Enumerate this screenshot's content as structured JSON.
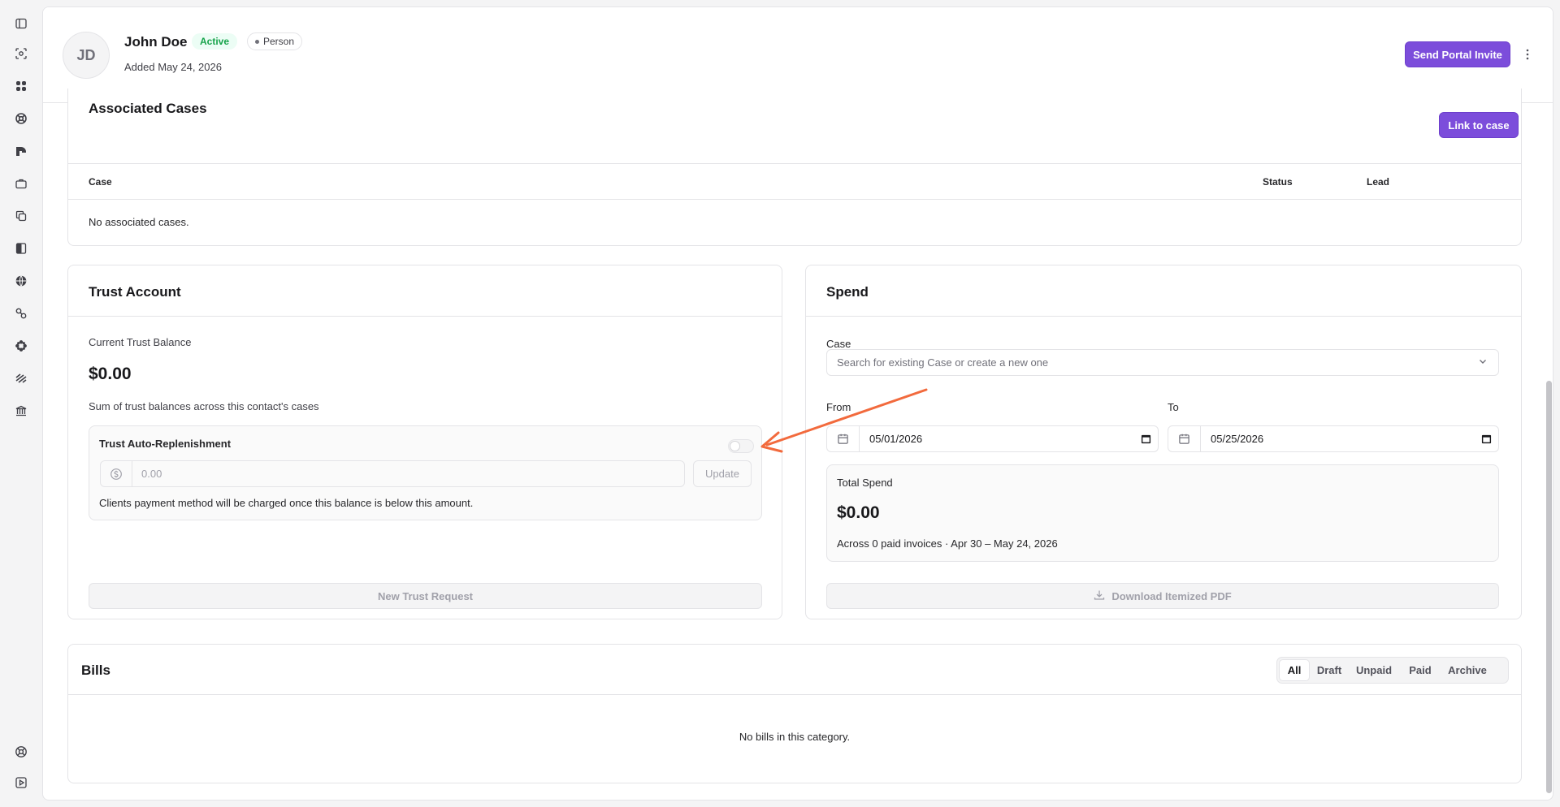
{
  "sidebar": {
    "icons": [
      "sidebar-toggle-icon",
      "scan-icon",
      "dashboard-icon",
      "lifebuoy-icon",
      "chart-icon",
      "briefcase-icon",
      "copy-icon",
      "book-icon",
      "globe-icon",
      "link-icon",
      "apps-icon",
      "signature-icon",
      "bank-icon"
    ],
    "bottom_icons": [
      "help-icon",
      "play-icon"
    ]
  },
  "header": {
    "avatar_initials": "JD",
    "name": "John Doe",
    "status_badge": "Active",
    "type_badge": "Person",
    "added": "Added May 24, 2026",
    "send_invite_label": "Send Portal Invite"
  },
  "cases": {
    "title": "Associated Cases",
    "link_label": "Link to case",
    "columns": [
      "Case",
      "Status",
      "Lead"
    ],
    "empty": "No associated cases."
  },
  "trust": {
    "title": "Trust Account",
    "balance_label": "Current Trust Balance",
    "balance": "$0.00",
    "balance_note": "Sum of trust balances across this contact's cases",
    "replenish_title": "Trust Auto-Replenishment",
    "replenish_enabled": false,
    "amount_placeholder": "0.00",
    "update_label": "Update",
    "replenish_note": "Clients payment method will be charged once this balance is below this amount.",
    "new_request_label": "New Trust Request"
  },
  "spend": {
    "title": "Spend",
    "case_label": "Case",
    "case_placeholder": "Search for existing Case or create a new one",
    "from_label": "From",
    "from_value": "05/01/2026",
    "to_label": "To",
    "to_value": "05/25/2026",
    "total_label": "Total Spend",
    "total_value": "$0.00",
    "total_note": "Across 0 paid invoices · Apr 30 – May 24, 2026",
    "download_label": "Download Itemized PDF"
  },
  "bills": {
    "title": "Bills",
    "tabs": [
      "All",
      "Draft",
      "Unpaid",
      "Paid",
      "Archive"
    ],
    "active_tab": "All",
    "empty": "No bills in this category."
  },
  "colors": {
    "accent": "#7c4ddb",
    "active_badge_bg": "#ecfdf5",
    "active_badge_text": "#16a34a",
    "annotation_arrow": "#f26a3d"
  }
}
